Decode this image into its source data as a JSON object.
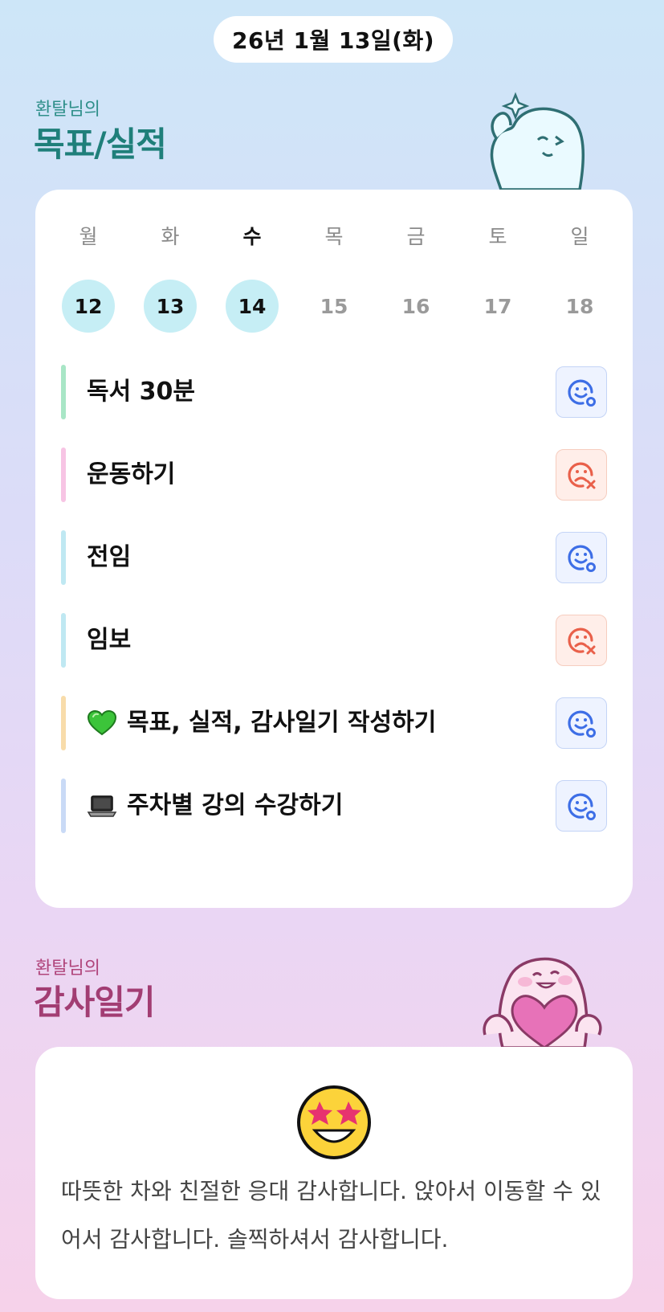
{
  "header": {
    "date": "26년 1월 13일(화)"
  },
  "goals_section": {
    "subtitle": "환탈님의",
    "title": "목표/실적",
    "mascot": "sparkle-ghost-mascot",
    "week": [
      {
        "day": "월",
        "date": "12",
        "active": true,
        "current": false
      },
      {
        "day": "화",
        "date": "13",
        "active": true,
        "current": false
      },
      {
        "day": "수",
        "date": "14",
        "active": true,
        "current": true
      },
      {
        "day": "목",
        "date": "15",
        "active": false,
        "current": false
      },
      {
        "day": "금",
        "date": "16",
        "active": false,
        "current": false
      },
      {
        "day": "토",
        "date": "17",
        "active": false,
        "current": false
      },
      {
        "day": "일",
        "date": "18",
        "active": false,
        "current": false
      }
    ],
    "goals": [
      {
        "label": "독서 30분",
        "bar_color": "#a8e6c6",
        "icon": "",
        "status": "achieved",
        "status_icon": "smile-check-icon"
      },
      {
        "label": "운동하기",
        "bar_color": "#f7c4e4",
        "icon": "",
        "status": "missed",
        "status_icon": "sad-x-icon"
      },
      {
        "label": "전임",
        "bar_color": "#bfe8f2",
        "icon": "",
        "status": "achieved",
        "status_icon": "smile-check-icon"
      },
      {
        "label": "임보",
        "bar_color": "#bfe8f2",
        "icon": "",
        "status": "missed",
        "status_icon": "sad-x-icon"
      },
      {
        "label": "목표, 실적, 감사일기 작성하기",
        "bar_color": "#f8dcaa",
        "icon": "green-heart-icon",
        "status": "achieved",
        "status_icon": "smile-check-icon"
      },
      {
        "label": "주차별 강의 수강하기",
        "bar_color": "#c9daf6",
        "icon": "laptop-icon",
        "status": "achieved",
        "status_icon": "smile-check-icon"
      }
    ],
    "colors": {
      "achieved": "#3d6ee6",
      "missed": "#e9604a",
      "day_active": "#c6eef5"
    }
  },
  "gratitude_section": {
    "subtitle": "환탈님의",
    "title": "감사일기",
    "mascot": "heart-holding-mascot",
    "emotion_icon": "star-struck-face-icon",
    "text": "따뜻한 차와 친절한 응대 감사합니다. 앉아서 이동할 수 있어서 감사합니다. 솔찍하셔서 감사합니다."
  }
}
